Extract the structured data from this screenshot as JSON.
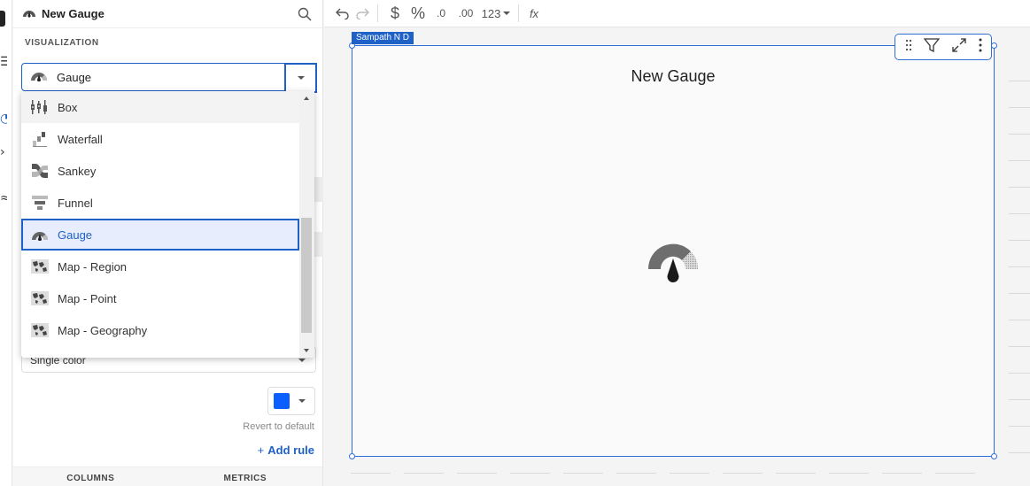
{
  "panel": {
    "title": "New Gauge",
    "section_label": "VISUALIZATION",
    "selected_visualization": "Gauge",
    "color_select_value": "Single color",
    "swatch_color": "#0b5fff",
    "revert_label": "Revert to default",
    "add_rule_plus": "+",
    "add_rule_label": "Add rule",
    "tabs": [
      "COLUMNS",
      "METRICS"
    ]
  },
  "dropdown": {
    "items": [
      {
        "label": "Box",
        "icon": "box-plot-icon",
        "state": "hover"
      },
      {
        "label": "Waterfall",
        "icon": "waterfall-chart-icon",
        "state": ""
      },
      {
        "label": "Sankey",
        "icon": "sankey-chart-icon",
        "state": ""
      },
      {
        "label": "Funnel",
        "icon": "funnel-chart-icon",
        "state": ""
      },
      {
        "label": "Gauge",
        "icon": "gauge-icon",
        "state": "selected"
      },
      {
        "label": "Map - Region",
        "icon": "map-icon",
        "state": ""
      },
      {
        "label": "Map - Point",
        "icon": "map-icon",
        "state": ""
      },
      {
        "label": "Map - Geography",
        "icon": "map-icon",
        "state": ""
      }
    ]
  },
  "toolbar": {
    "undo_icon": "undo-icon",
    "redo_icon": "redo-icon",
    "currency": "$",
    "percent": "%",
    "decrease_decimals": ".0",
    "increase_decimals": ".00",
    "number_format": "123",
    "formula": "fx"
  },
  "tile": {
    "owner": "Sampath N D",
    "title": "New Gauge"
  },
  "colors": {
    "accent": "#1e61c7",
    "selected_bg": "#e7edfc"
  }
}
